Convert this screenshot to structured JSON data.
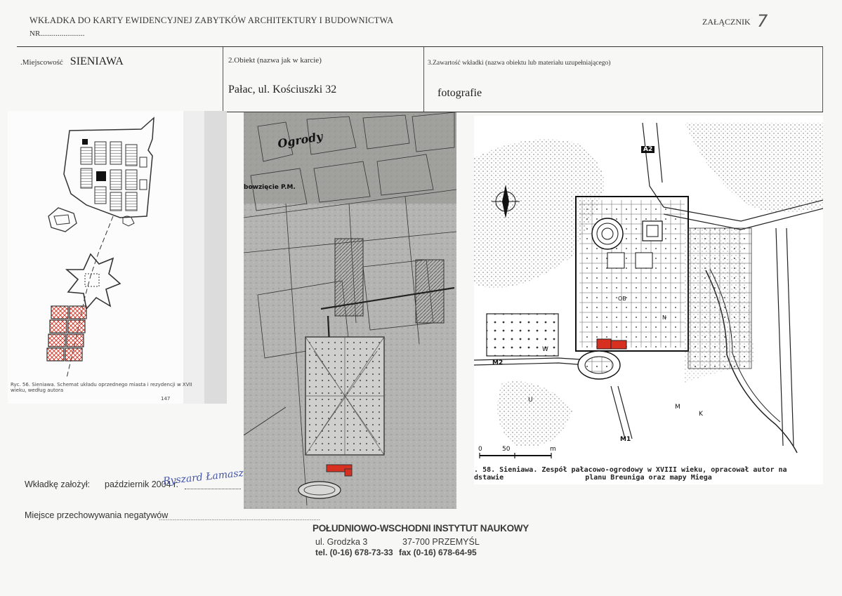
{
  "header": {
    "title": "WKŁADKA DO KARTY EWIDENCYJNEJ ZABYTKÓW ARCHITEKTURY I BUDOWNICTWA",
    "nr": "NR.......................",
    "zalacznik_label": "ZAŁĄCZNIK",
    "zalacznik_number": "7"
  },
  "fields": {
    "miejscowosc_label": ".Miejscowość",
    "miejscowosc_value": "SIENIAWA",
    "obiekt_label": "2.Obiekt (nazwa jak w karcie)",
    "obiekt_value": "Pałac, ul. Kościuszki 32",
    "zawartosc_label": "3.Zawartość wkładki (nazwa  obiektu lub materiału uzupełniającego)",
    "zawartosc_value": "fotografie"
  },
  "images": {
    "plan1_caption": "Ryc. 56. Sieniawa. Schemat układu oprzednego miasta i rezydencji w XVII wieku, według autora",
    "plan1_page": "147",
    "map2_label": "Ogrody",
    "map2_label2": "bowzięcie P.M.",
    "map3_caption_line1": "yc. 58. Sieniawa. Zespół pałacowo-ogrodowy w XVIII wieku, opracował autor na podstawie",
    "map3_caption_line2": "planu Breuniga oraz mapy Miega",
    "map3_labels": {
      "a2": "A2",
      "m2": "M2",
      "m1": "M1",
      "w": "W",
      "u": "U",
      "m": "M",
      "k": "K",
      "ob": "OB",
      "n": "N",
      "scale_0": "0",
      "scale_50": "50",
      "scale_m": "m"
    }
  },
  "footer": {
    "zalozyl_label": "Wkładkę założył:",
    "zalozyl_date": "październik 2004 r.",
    "signature": "Ryszard Łamasz",
    "miejsce_label": "Miejsce przechowywania negatywów",
    "miejsce_dots": "............................................................................................"
  },
  "stamp": {
    "name": "POŁUDNIOWO-WSCHODNI INSTYTUT NAUKOWY",
    "street": "ul. Grodzka 3",
    "city": "37-700 PRZEMYŚL",
    "tel": "tel. (0-16) 678-73-33",
    "fax": "fax (0-16) 678-64-95"
  },
  "colors": {
    "highlight_red": "#d83020",
    "ink": "#222222"
  }
}
